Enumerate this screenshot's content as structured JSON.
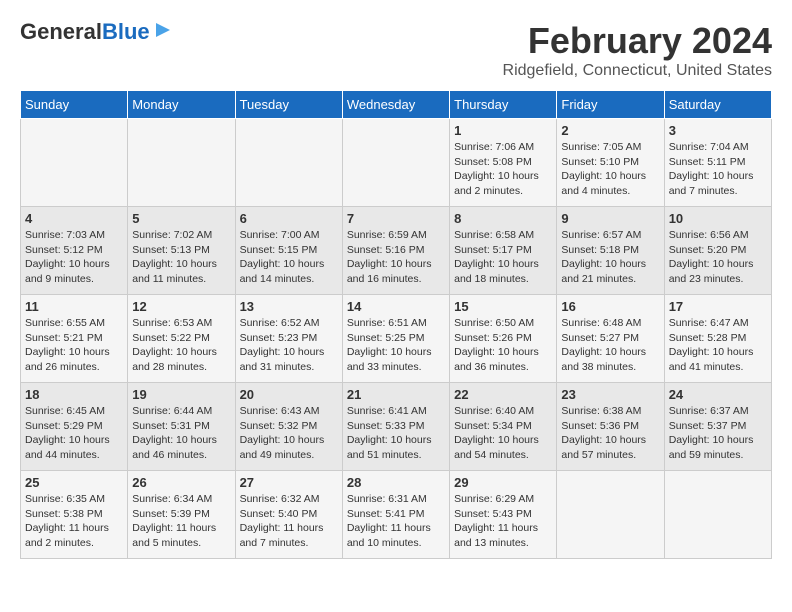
{
  "header": {
    "logo_general": "General",
    "logo_blue": "Blue",
    "month_title": "February 2024",
    "location": "Ridgefield, Connecticut, United States"
  },
  "days_of_week": [
    "Sunday",
    "Monday",
    "Tuesday",
    "Wednesday",
    "Thursday",
    "Friday",
    "Saturday"
  ],
  "weeks": [
    [
      {
        "day": "",
        "info": ""
      },
      {
        "day": "",
        "info": ""
      },
      {
        "day": "",
        "info": ""
      },
      {
        "day": "",
        "info": ""
      },
      {
        "day": "1",
        "info": "Sunrise: 7:06 AM\nSunset: 5:08 PM\nDaylight: 10 hours\nand 2 minutes."
      },
      {
        "day": "2",
        "info": "Sunrise: 7:05 AM\nSunset: 5:10 PM\nDaylight: 10 hours\nand 4 minutes."
      },
      {
        "day": "3",
        "info": "Sunrise: 7:04 AM\nSunset: 5:11 PM\nDaylight: 10 hours\nand 7 minutes."
      }
    ],
    [
      {
        "day": "4",
        "info": "Sunrise: 7:03 AM\nSunset: 5:12 PM\nDaylight: 10 hours\nand 9 minutes."
      },
      {
        "day": "5",
        "info": "Sunrise: 7:02 AM\nSunset: 5:13 PM\nDaylight: 10 hours\nand 11 minutes."
      },
      {
        "day": "6",
        "info": "Sunrise: 7:00 AM\nSunset: 5:15 PM\nDaylight: 10 hours\nand 14 minutes."
      },
      {
        "day": "7",
        "info": "Sunrise: 6:59 AM\nSunset: 5:16 PM\nDaylight: 10 hours\nand 16 minutes."
      },
      {
        "day": "8",
        "info": "Sunrise: 6:58 AM\nSunset: 5:17 PM\nDaylight: 10 hours\nand 18 minutes."
      },
      {
        "day": "9",
        "info": "Sunrise: 6:57 AM\nSunset: 5:18 PM\nDaylight: 10 hours\nand 21 minutes."
      },
      {
        "day": "10",
        "info": "Sunrise: 6:56 AM\nSunset: 5:20 PM\nDaylight: 10 hours\nand 23 minutes."
      }
    ],
    [
      {
        "day": "11",
        "info": "Sunrise: 6:55 AM\nSunset: 5:21 PM\nDaylight: 10 hours\nand 26 minutes."
      },
      {
        "day": "12",
        "info": "Sunrise: 6:53 AM\nSunset: 5:22 PM\nDaylight: 10 hours\nand 28 minutes."
      },
      {
        "day": "13",
        "info": "Sunrise: 6:52 AM\nSunset: 5:23 PM\nDaylight: 10 hours\nand 31 minutes."
      },
      {
        "day": "14",
        "info": "Sunrise: 6:51 AM\nSunset: 5:25 PM\nDaylight: 10 hours\nand 33 minutes."
      },
      {
        "day": "15",
        "info": "Sunrise: 6:50 AM\nSunset: 5:26 PM\nDaylight: 10 hours\nand 36 minutes."
      },
      {
        "day": "16",
        "info": "Sunrise: 6:48 AM\nSunset: 5:27 PM\nDaylight: 10 hours\nand 38 minutes."
      },
      {
        "day": "17",
        "info": "Sunrise: 6:47 AM\nSunset: 5:28 PM\nDaylight: 10 hours\nand 41 minutes."
      }
    ],
    [
      {
        "day": "18",
        "info": "Sunrise: 6:45 AM\nSunset: 5:29 PM\nDaylight: 10 hours\nand 44 minutes."
      },
      {
        "day": "19",
        "info": "Sunrise: 6:44 AM\nSunset: 5:31 PM\nDaylight: 10 hours\nand 46 minutes."
      },
      {
        "day": "20",
        "info": "Sunrise: 6:43 AM\nSunset: 5:32 PM\nDaylight: 10 hours\nand 49 minutes."
      },
      {
        "day": "21",
        "info": "Sunrise: 6:41 AM\nSunset: 5:33 PM\nDaylight: 10 hours\nand 51 minutes."
      },
      {
        "day": "22",
        "info": "Sunrise: 6:40 AM\nSunset: 5:34 PM\nDaylight: 10 hours\nand 54 minutes."
      },
      {
        "day": "23",
        "info": "Sunrise: 6:38 AM\nSunset: 5:36 PM\nDaylight: 10 hours\nand 57 minutes."
      },
      {
        "day": "24",
        "info": "Sunrise: 6:37 AM\nSunset: 5:37 PM\nDaylight: 10 hours\nand 59 minutes."
      }
    ],
    [
      {
        "day": "25",
        "info": "Sunrise: 6:35 AM\nSunset: 5:38 PM\nDaylight: 11 hours\nand 2 minutes."
      },
      {
        "day": "26",
        "info": "Sunrise: 6:34 AM\nSunset: 5:39 PM\nDaylight: 11 hours\nand 5 minutes."
      },
      {
        "day": "27",
        "info": "Sunrise: 6:32 AM\nSunset: 5:40 PM\nDaylight: 11 hours\nand 7 minutes."
      },
      {
        "day": "28",
        "info": "Sunrise: 6:31 AM\nSunset: 5:41 PM\nDaylight: 11 hours\nand 10 minutes."
      },
      {
        "day": "29",
        "info": "Sunrise: 6:29 AM\nSunset: 5:43 PM\nDaylight: 11 hours\nand 13 minutes."
      },
      {
        "day": "",
        "info": ""
      },
      {
        "day": "",
        "info": ""
      }
    ]
  ]
}
